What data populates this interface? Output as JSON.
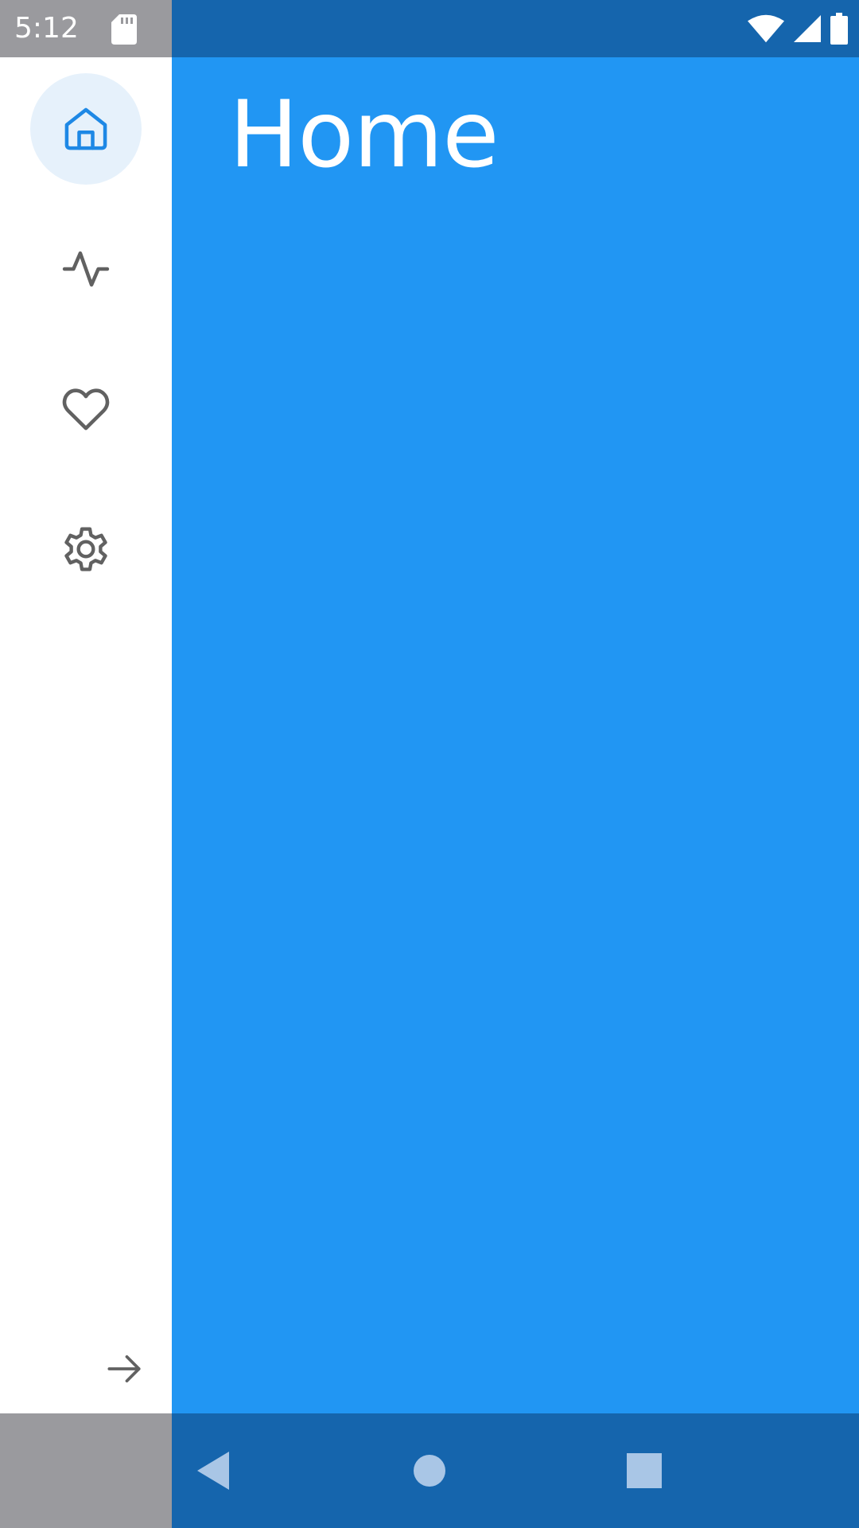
{
  "status_bar": {
    "time": "5:12",
    "icons": [
      "sd-card-icon",
      "wifi-icon",
      "cell-signal-icon",
      "battery-icon"
    ]
  },
  "side_rail": {
    "items": [
      {
        "id": "home",
        "icon": "home-icon",
        "active": true
      },
      {
        "id": "activity",
        "icon": "activity-pulse-icon",
        "active": false
      },
      {
        "id": "favorites",
        "icon": "heart-icon",
        "active": false
      },
      {
        "id": "settings",
        "icon": "gear-icon",
        "active": false
      }
    ],
    "expand_icon": "arrow-right-icon"
  },
  "main": {
    "title": "Home"
  },
  "nav_bar": {
    "buttons": [
      "back-icon",
      "home-circle-icon",
      "recents-square-icon"
    ]
  },
  "colors": {
    "primary": "#2196F3",
    "primary_dark": "#1565AD",
    "rail_background": "#FFFFFF",
    "active_item_background": "#E6F1FB",
    "active_icon": "#1E88E5",
    "inactive_icon": "#616161",
    "title_text": "#FFFFFF"
  }
}
